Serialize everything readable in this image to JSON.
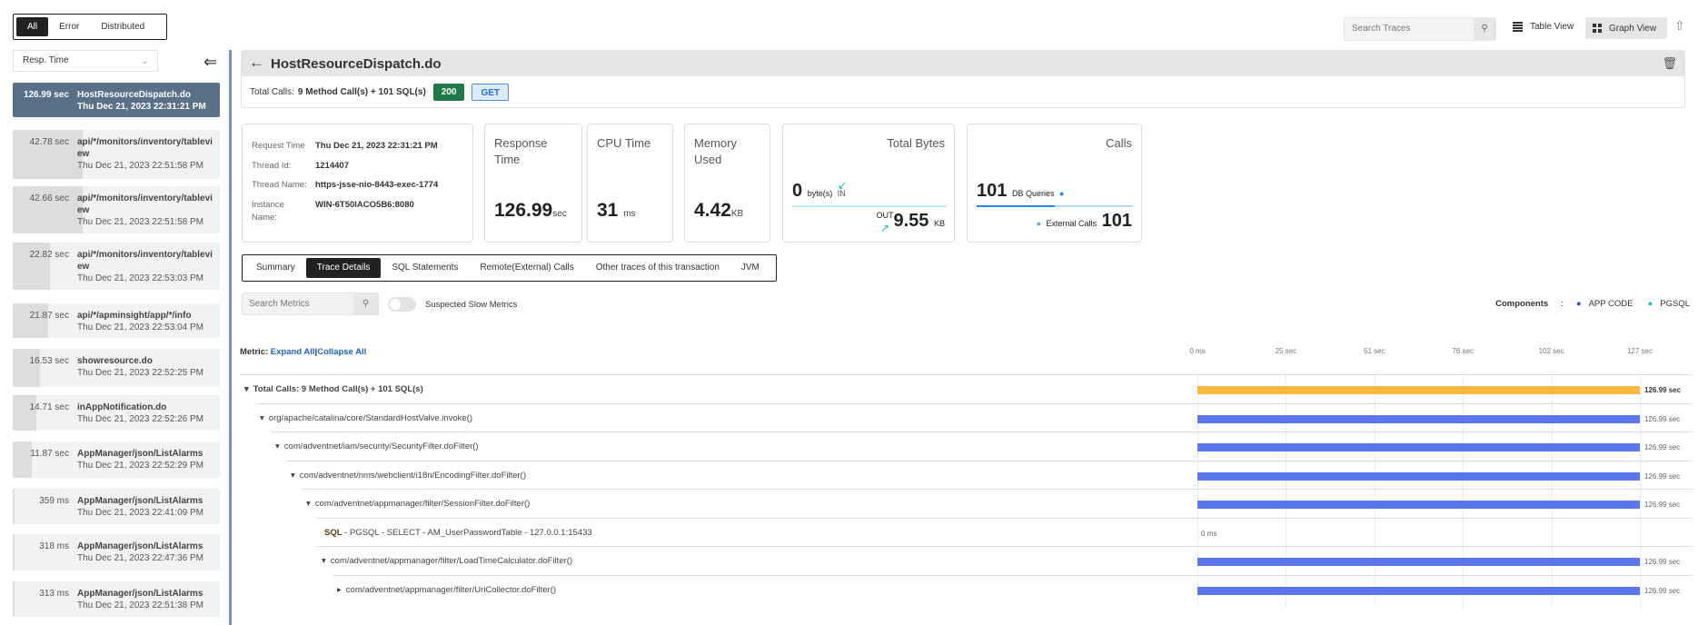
{
  "filter_tabs": [
    {
      "label": "All",
      "active": true
    },
    {
      "label": "Error",
      "active": false
    },
    {
      "label": "Distributed",
      "active": false
    }
  ],
  "sort_select": {
    "value": "Resp. Time"
  },
  "trace_list": [
    {
      "time": "126.99 sec",
      "name": "HostResourceDispatch.do",
      "date": "Thu Dec 21, 2023 22:31:21 PM",
      "selected": true,
      "fill": 1
    },
    {
      "time": "42.78 sec",
      "name": "api/*/monitors/inventory/tableview",
      "date": "Thu Dec 21, 2023 22:51:58 PM",
      "fill": 0.337
    },
    {
      "time": "42.66 sec",
      "name": "api/*/monitors/inventory/tableview",
      "date": "Thu Dec 21, 2023 22:51:58 PM",
      "fill": 0.336
    },
    {
      "time": "22.82 sec",
      "name": "api/*/monitors/inventory/tableview",
      "date": "Thu Dec 21, 2023 22:53:03 PM",
      "fill": 0.18
    },
    {
      "time": "21.87 sec",
      "name": "api/*/apminsight/app/*/info",
      "date": "Thu Dec 21, 2023 22:53:04 PM",
      "fill": 0.172
    },
    {
      "time": "16.53 sec",
      "name": "showresource.do",
      "date": "Thu Dec 21, 2023 22:52:25 PM",
      "fill": 0.13
    },
    {
      "time": "14.71 sec",
      "name": "inAppNotification.do",
      "date": "Thu Dec 21, 2023 22:52:26 PM",
      "fill": 0.116
    },
    {
      "time": "11.87 sec",
      "name": "AppManager/json/ListAlarms",
      "date": "Thu Dec 21, 2023 22:52:29 PM",
      "fill": 0.093
    },
    {
      "time": "359 ms",
      "name": "AppManager/json/ListAlarms",
      "date": "Thu Dec 21, 2023 22:41:09 PM",
      "fill": 0.003
    },
    {
      "time": "318 ms",
      "name": "AppManager/json/ListAlarms",
      "date": "Thu Dec 21, 2023 22:47:36 PM",
      "fill": 0.003
    },
    {
      "time": "313 ms",
      "name": "AppManager/json/ListAlarms",
      "date": "Thu Dec 21, 2023 22:51:38 PM",
      "fill": 0.002
    }
  ],
  "toolbar": {
    "search_placeholder": "Search Traces",
    "table_view": "Table View",
    "graph_view": "Graph View"
  },
  "header": {
    "title": "HostResourceDispatch.do",
    "total_calls_label": "Total Calls:",
    "total_calls_value": "9 Method Call(s) + 101 SQL(s)",
    "status": "200",
    "method": "GET"
  },
  "info": {
    "request_time_label": "Request Time",
    "request_time": "Thu Dec 21, 2023 22:31:21 PM",
    "thread_id_label": "Thread Id:",
    "thread_id": "1214407",
    "thread_name_label": "Thread Name:",
    "thread_name": "https-jsse-nio-8443-exec-1774",
    "instance_label": "Instance Name:",
    "instance": "WIN-6T50IACO5B6:8080"
  },
  "metrics": {
    "response": {
      "label": "Response Time",
      "value": "126.99",
      "unit": "sec"
    },
    "cpu": {
      "label": "CPU Time",
      "value": "31",
      "unit": "ms"
    },
    "memory": {
      "label": "Memory Used",
      "value": "4.42",
      "unit": "KB"
    },
    "bytes": {
      "label": "Total Bytes",
      "in_value": "0",
      "in_unit": "byte(s)",
      "in_label": "IN",
      "out_label": "OUT",
      "out_value": "9.55",
      "out_unit": "KB"
    },
    "calls": {
      "label": "Calls",
      "db_value": "101",
      "db_label": "DB Queries",
      "ext_label": "External Calls",
      "ext_value": "101"
    }
  },
  "tabs": [
    {
      "label": "Summary"
    },
    {
      "label": "Trace Details",
      "active": true
    },
    {
      "label": "SQL Statements"
    },
    {
      "label": "Remote(External) Calls"
    },
    {
      "label": "Other traces of this transaction"
    },
    {
      "label": "JVM"
    }
  ],
  "metric_search": {
    "placeholder": "Search Metrics"
  },
  "slow_toggle": {
    "label": "Suspected Slow Metrics",
    "on": false
  },
  "components": {
    "label": "Components",
    "sep": ":",
    "items": [
      {
        "label": "APP CODE",
        "color": "#2f55e0"
      },
      {
        "label": "PGSQL",
        "color": "#17c2bd"
      }
    ]
  },
  "tree": {
    "metric_label": "Metric:",
    "expand_all": "Expand All",
    "sep": "|",
    "collapse_all": "Collapse All",
    "axis_ticks": [
      "0 ms",
      "25 sec",
      "51 sec",
      "76 sec",
      "102 sec",
      "127 sec"
    ],
    "axis_max_sec": 127,
    "rows": [
      {
        "prefix": "",
        "label": "Total Calls: 9 Method Call(s) + 101 SQL(s)",
        "depth": 0,
        "toggle": "expanded",
        "duration_sec": 126.99,
        "value": "126.99 sec",
        "color": "#f9b93f",
        "bold": true
      },
      {
        "prefix": "",
        "label": "org/apache/catalina/core/StandardHostValve.invoke()",
        "depth": 1,
        "toggle": "expanded",
        "duration_sec": 126.99,
        "value": "126.99 sec",
        "color": "#5a78ea"
      },
      {
        "prefix": "",
        "label": "com/adventnet/iam/security/SecurityFilter.doFilter()",
        "depth": 2,
        "toggle": "expanded",
        "duration_sec": 126.99,
        "value": "126.99 sec",
        "color": "#5a78ea"
      },
      {
        "prefix": "",
        "label": "com/adventnet/nms/webclient/i18n/EncodingFilter.doFilter()",
        "depth": 3,
        "toggle": "expanded",
        "duration_sec": 126.99,
        "value": "126.99 sec",
        "color": "#5a78ea"
      },
      {
        "prefix": "",
        "label": "com/adventnet/appmanager/filter/SessionFilter.doFilter()",
        "depth": 4,
        "toggle": "expanded",
        "duration_sec": 126.99,
        "value": "126.99 sec",
        "color": "#5a78ea"
      },
      {
        "prefix": "SQL",
        "label": " - PGSQL - SELECT - AM_UserPasswordTable - 127.0.0.1:15433",
        "depth": 5,
        "toggle": "none",
        "duration_sec": 0,
        "value": "0 ms",
        "color": "#17c2bd"
      },
      {
        "prefix": "",
        "label": "com/adventnet/appmanager/filter/LoadTimeCalculator.doFilter()",
        "depth": 5,
        "toggle": "expanded",
        "duration_sec": 126.99,
        "value": "126.99 sec",
        "color": "#5a78ea"
      },
      {
        "prefix": "",
        "label": "com/adventnet/appmanager/filter/UriCollector.doFilter()",
        "depth": 6,
        "toggle": "collapsed",
        "duration_sec": 126.99,
        "value": "126.99 sec",
        "color": "#5a78ea"
      }
    ]
  }
}
